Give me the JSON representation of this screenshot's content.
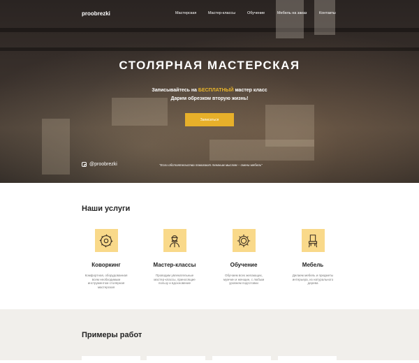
{
  "header": {
    "logo": "proobrezki",
    "nav": [
      "Мастерская",
      "Мастер-классы",
      "Обучение",
      "Мебель на заказ",
      "Контакты"
    ]
  },
  "hero": {
    "title": "СТОЛЯРНАЯ МАСТЕРСКАЯ",
    "sub_before": "Записывайтесь на ",
    "sub_accent": "БЕСПЛАТНЫЙ",
    "sub_after": " мастер класс",
    "sub_line2": "Дарим обрезком вторую жизнь!",
    "cta": "Записаться",
    "instagram": "@proobrezki",
    "quote": "\"Если обстоятельства помогают темным мыслям – смени мебель\""
  },
  "services": {
    "title": "Наши услуги",
    "items": [
      {
        "icon": "saw-blade-icon",
        "title": "Коворкинг",
        "desc": "Комфортная, оборудованная всем необходимым инструментом столярная мастерская"
      },
      {
        "icon": "craftsman-icon",
        "title": "Мастер-классы",
        "desc": "Проводим увлекательные мастер-классы, приносящие пользу и вдохновение"
      },
      {
        "icon": "training-gear-icon",
        "title": "Обучение",
        "desc": "Обучаем всех желающих, мужчин и женщин, с любым уровнем подготовки"
      },
      {
        "icon": "chair-icon",
        "title": "Мебель",
        "desc": "Делаем мебель и предметы интерьера, из натурального дерева"
      }
    ]
  },
  "portfolio": {
    "title": "Примеры работ"
  },
  "colors": {
    "accent": "#e7b02a",
    "icon_bg": "#f9d98a",
    "section_bg": "#f1efeb"
  }
}
